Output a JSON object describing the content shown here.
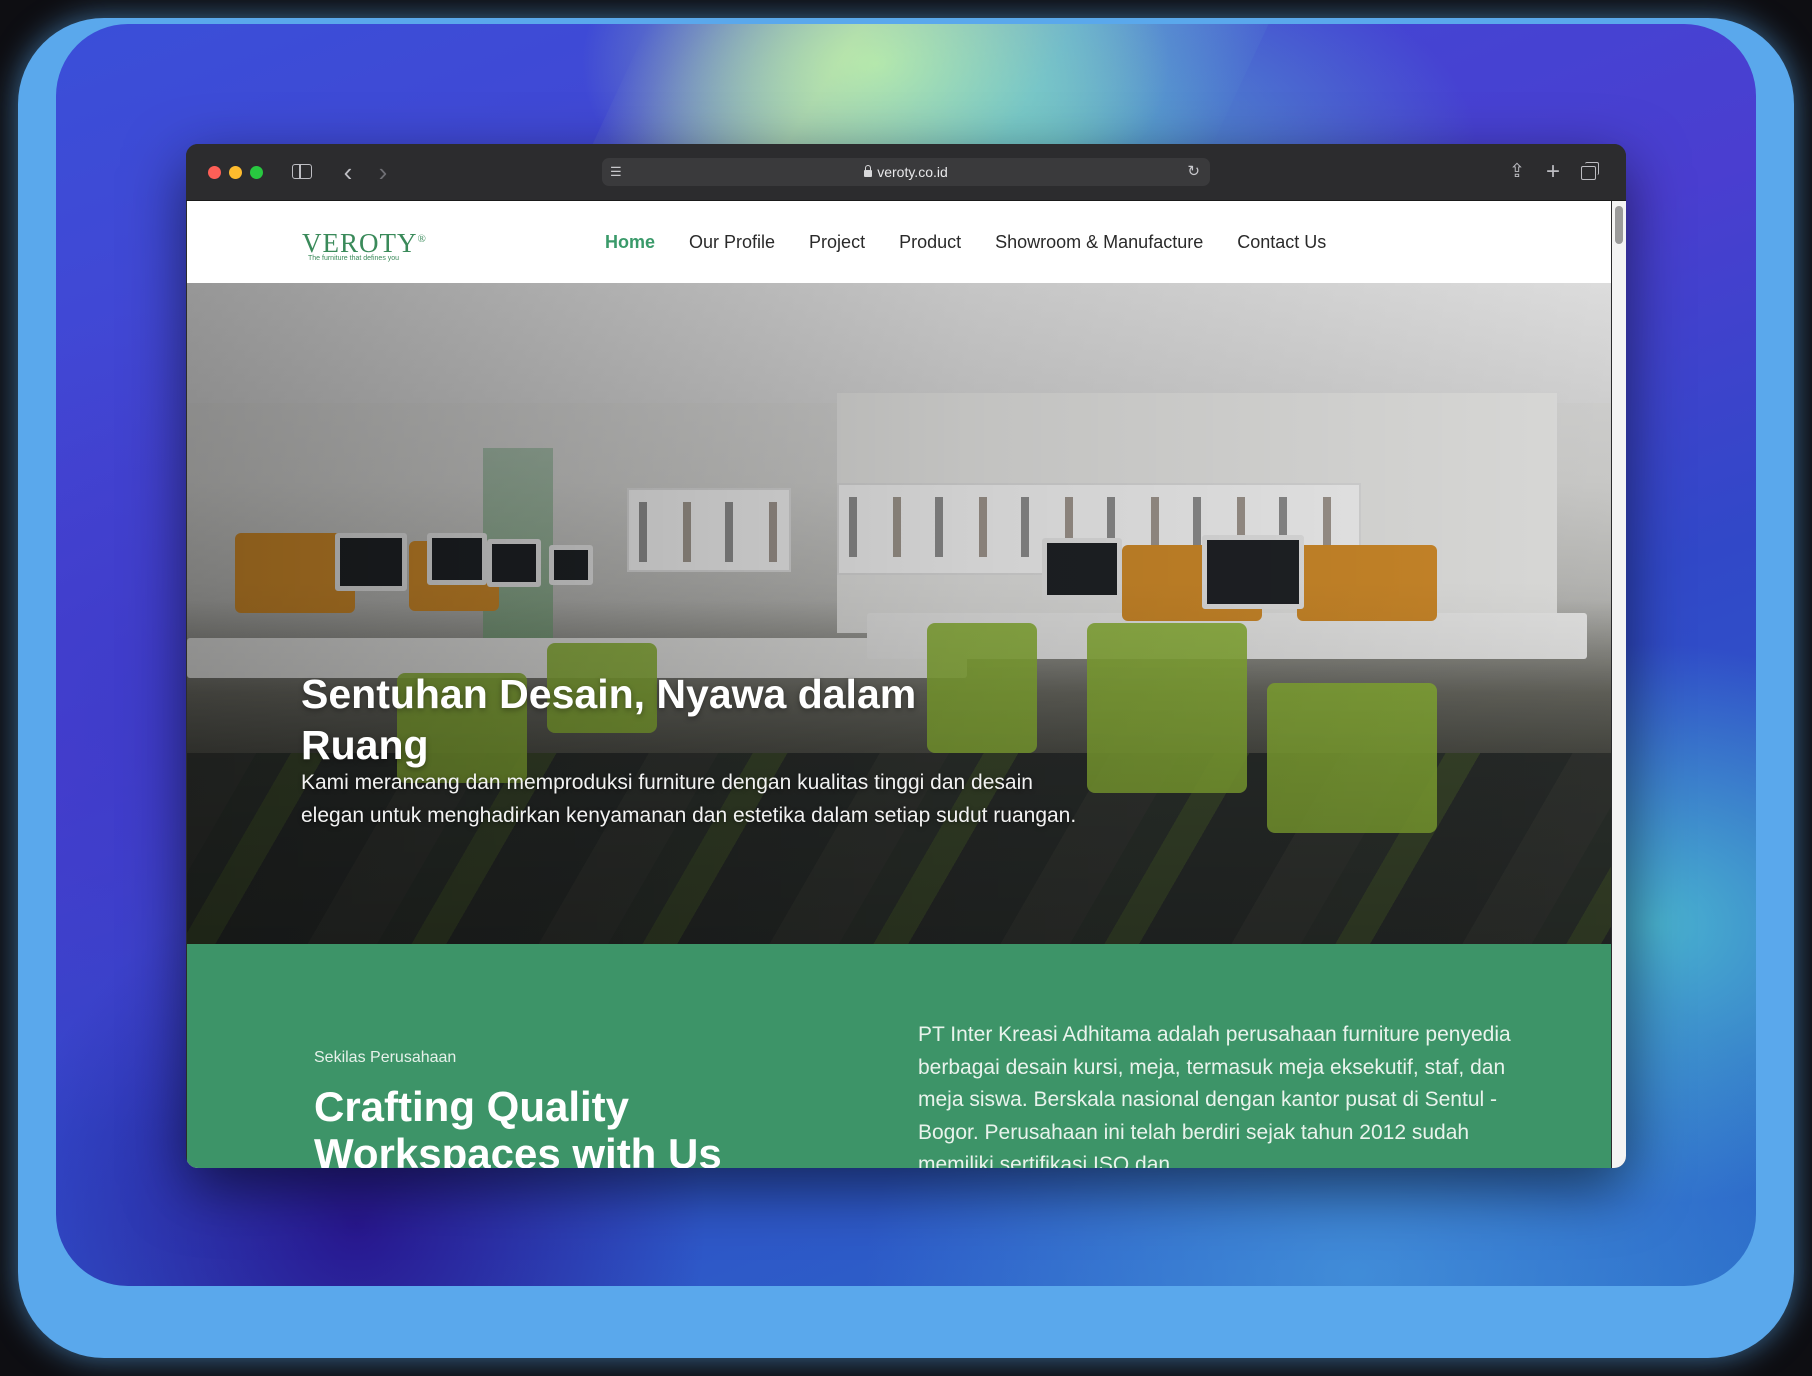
{
  "browser": {
    "url": "veroty.co.id"
  },
  "site": {
    "logo": {
      "name": "VEROTY",
      "registered_mark": "®",
      "tagline": "The furniture that defines you"
    },
    "nav": [
      {
        "label": "Home",
        "active": true
      },
      {
        "label": "Our Profile",
        "active": false
      },
      {
        "label": "Project",
        "active": false
      },
      {
        "label": "Product",
        "active": false
      },
      {
        "label": "Showroom & Manufacture",
        "active": false
      },
      {
        "label": "Contact Us",
        "active": false
      }
    ]
  },
  "hero": {
    "title": "Sentuhan Desain, Nyawa dalam Ruang",
    "description": "Kami merancang dan memproduksi furniture dengan kualitas tinggi dan desain elegan untuk menghadirkan kenyamanan dan estetika dalam setiap sudut ruangan."
  },
  "about": {
    "eyebrow": "Sekilas Perusahaan",
    "title": "Crafting Quality Workspaces with Us",
    "text": "PT Inter Kreasi Adhitama adalah perusahaan furniture penyedia berbagai desain kursi, meja, termasuk meja eksekutif, staf, dan meja siswa. Berskala nasional dengan kantor pusat di Sentul - Bogor. Perusahaan ini telah berdiri sejak tahun 2012 sudah memiliki sertifikasi ISO dan"
  },
  "colors": {
    "brand_green": "#3d9468",
    "nav_active": "#3a9a6a"
  }
}
